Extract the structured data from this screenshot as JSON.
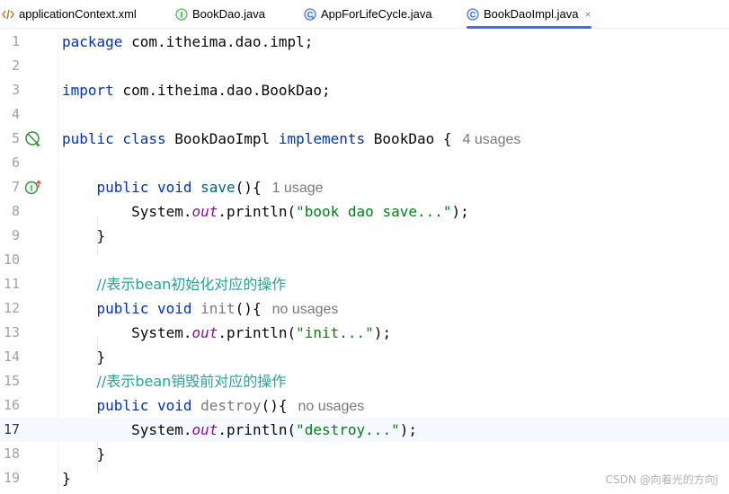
{
  "tabs": [
    {
      "label": "applicationContext.xml",
      "icon": "xml-file-icon"
    },
    {
      "label": "BookDao.java",
      "icon": "interface-icon"
    },
    {
      "label": "AppForLifeCycle.java",
      "icon": "runnable-class-icon"
    },
    {
      "label": "BookDaoImpl.java",
      "icon": "class-icon",
      "active": true,
      "close": "×"
    }
  ],
  "editor": {
    "current_line": 17,
    "lines": {
      "l1": {
        "n": "1",
        "kw": "package",
        "rest": " com.itheima.dao.impl;"
      },
      "l2": {
        "n": "2"
      },
      "l3": {
        "n": "3",
        "kw": "import",
        "rest": " com.itheima.dao.BookDao;"
      },
      "l4": {
        "n": "4"
      },
      "l5": {
        "n": "5",
        "kw1": "public class",
        "name": " BookDaoImpl ",
        "kw2": "implements",
        "rest": " BookDao {",
        "hint": "4 usages"
      },
      "l6": {
        "n": "6"
      },
      "l7": {
        "n": "7",
        "kw": "public void",
        "name": " save",
        "rest": "(){",
        "hint": "1 usage"
      },
      "l8": {
        "n": "8",
        "a": "System.",
        "fld": "out",
        "b": ".println(",
        "str": "\"book dao save...\"",
        "c": ");"
      },
      "l9": {
        "n": "9",
        "text": "}"
      },
      "l10": {
        "n": "10"
      },
      "l11": {
        "n": "11",
        "text": "//表示bean初始化对应的操作"
      },
      "l12": {
        "n": "12",
        "kw": "public void",
        "name": " init",
        "rest": "(){",
        "hint": "no usages"
      },
      "l13": {
        "n": "13",
        "a": "System.",
        "fld": "out",
        "b": ".println(",
        "str": "\"init...\"",
        "c": ");"
      },
      "l14": {
        "n": "14",
        "text": "}"
      },
      "l15": {
        "n": "15",
        "text": "//表示bean销毁前对应的操作"
      },
      "l16": {
        "n": "16",
        "kw": "public void",
        "name": " destroy",
        "rest": "(){",
        "hint": "no usages"
      },
      "l17": {
        "n": "17",
        "a": "System.",
        "fld": "out",
        "b": ".println(",
        "str": "\"destroy...\"",
        "c": ");"
      },
      "l18": {
        "n": "18",
        "text": "}"
      },
      "l19": {
        "n": "19",
        "text": "}"
      }
    }
  },
  "gutter_icons": {
    "l5": "implementation-marker-icon",
    "l7": "implements-method-icon"
  },
  "watermark": "CSDN @向着光的方向j",
  "colors": {
    "keyword": "#0033b3",
    "string": "#067d17",
    "static_field": "#871094",
    "comment": "#2aa198",
    "hint": "#7a7a7a",
    "line_number": "#a0a3aa",
    "current_line_bg": "#f5f8fe",
    "tab_underline": "#3574f0"
  }
}
